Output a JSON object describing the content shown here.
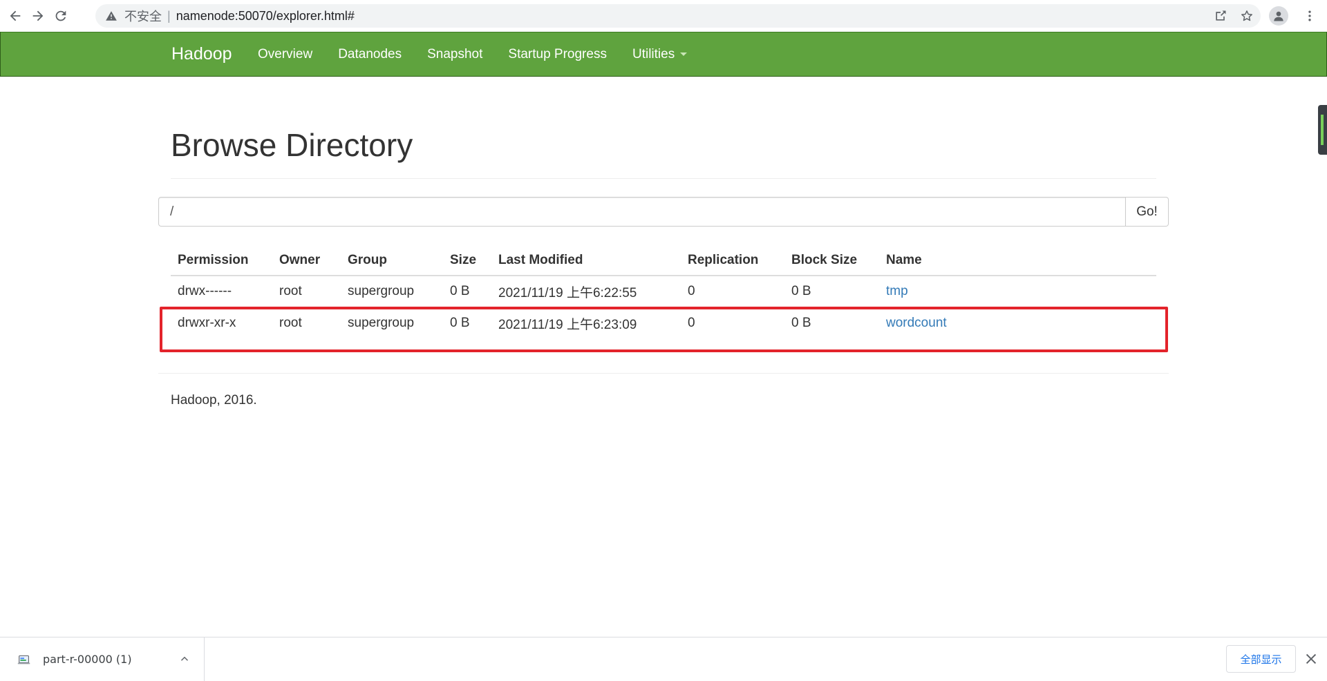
{
  "browser": {
    "security_label": "不安全",
    "separator": "|",
    "url": "namenode:50070/explorer.html#"
  },
  "navbar": {
    "brand": "Hadoop",
    "links": [
      "Overview",
      "Datanodes",
      "Snapshot",
      "Startup Progress",
      "Utilities"
    ],
    "color": "#5fa33e"
  },
  "page": {
    "title": "Browse Directory",
    "path_value": "/",
    "go_label": "Go!"
  },
  "table": {
    "headers": [
      "Permission",
      "Owner",
      "Group",
      "Size",
      "Last Modified",
      "Replication",
      "Block Size",
      "Name"
    ],
    "rows": [
      [
        "drwx------",
        "root",
        "supergroup",
        "0 B",
        "2021/11/19 上午6:22:55",
        "0",
        "0 B",
        "tmp"
      ],
      [
        "drwxr-xr-x",
        "root",
        "supergroup",
        "0 B",
        "2021/11/19 上午6:23:09",
        "0",
        "0 B",
        "wordcount"
      ]
    ],
    "highlighted_row": 1,
    "highlight_color": "#e3232b",
    "link_color": "#337ab7"
  },
  "footer": {
    "text": "Hadoop, 2016."
  },
  "download_bar": {
    "file_name": "part-r-00000 (1)",
    "show_all_label": "全部显示"
  }
}
